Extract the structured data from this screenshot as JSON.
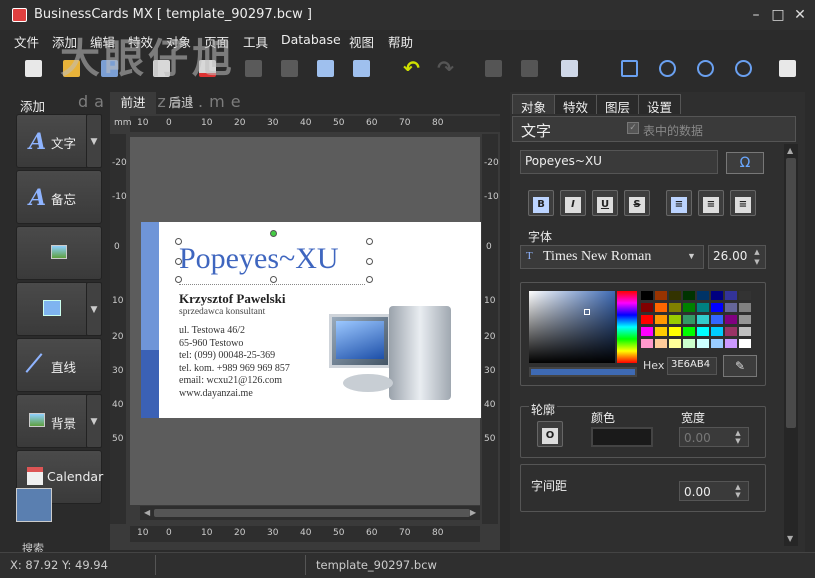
{
  "window": {
    "title": "BusinessCards MX [ template_90297.bcw ]",
    "minimize": "–",
    "maximize": "□",
    "close": "✕"
  },
  "menu": [
    "文件",
    "添加",
    "编辑",
    "特效",
    "对象",
    "页面",
    "工具",
    "Database",
    "视图",
    "帮助"
  ],
  "watermark": {
    "cn": "大眼仔旭",
    "en": "dayanzai.me"
  },
  "left_panel": {
    "tab": "添加",
    "tools": [
      {
        "label": "文字",
        "icon": "text-icon",
        "has_dropdown": true
      },
      {
        "label": "备忘",
        "icon": "memo-icon",
        "has_dropdown": false
      },
      {
        "label": "",
        "icon": "image-icon",
        "has_dropdown": false
      },
      {
        "label": "",
        "icon": "rectangle-icon",
        "has_dropdown": true
      },
      {
        "label": "直线",
        "icon": "line-icon",
        "has_dropdown": false
      },
      {
        "label": "背景",
        "icon": "background-icon",
        "has_dropdown": true
      },
      {
        "label": "Calendar",
        "icon": "calendar-icon",
        "has_dropdown": false
      }
    ],
    "search_label": "搜索"
  },
  "canvas": {
    "tabs": [
      "前进",
      "后退"
    ],
    "ruler_unit": "mm",
    "ruler_top": [
      "10",
      "0",
      "10",
      "20",
      "30",
      "40",
      "50",
      "60",
      "70",
      "80"
    ],
    "ruler_bottom": [
      "10",
      "0",
      "10",
      "20",
      "30",
      "40",
      "50",
      "60",
      "70",
      "80"
    ],
    "ruler_left": [
      "-20",
      "-10",
      "0",
      "10",
      "20",
      "30",
      "40",
      "50"
    ],
    "ruler_right": [
      "-20",
      "-10",
      "0",
      "10",
      "20",
      "30",
      "40",
      "50"
    ]
  },
  "card": {
    "name": "Popeyes~XU",
    "person": "Krzysztof Pawelski",
    "role": "sprzedawca konsultant",
    "lines": [
      "ul. Testowa 46/2",
      "65-960 Testowo",
      "tel: (099) 00048-25-369",
      "tel. kom. +989 969 969 857",
      "email: wcxu21@126.com",
      "www.dayanzai.me"
    ]
  },
  "right_panel": {
    "tabs": [
      "对象",
      "特效",
      "图层",
      "设置"
    ],
    "section_title": "文字",
    "table_data_label": "表中的数据",
    "text_value": "Popeyes~XU",
    "omega": "Ω",
    "format_buttons": [
      "B",
      "I",
      "U",
      "S"
    ],
    "font_label": "字体",
    "font_name": "Times New Roman",
    "font_size": "26.00",
    "hex_label": "Hex",
    "hex_value": "3E6AB4",
    "outline_label": "轮廓",
    "color_label": "颜色",
    "width_label": "宽度",
    "width_value": "0.00",
    "spacing_label": "字间距",
    "spacing_value": "0.00"
  },
  "status": {
    "coords": "X: 87.92 Y: 49.94",
    "file": "template_90297.bcw"
  },
  "colors": {
    "accent": "#3E6AB4",
    "swatches": [
      "#000000",
      "#993300",
      "#333300",
      "#003300",
      "#003366",
      "#000080",
      "#333399",
      "#333333",
      "#800000",
      "#ff6600",
      "#808000",
      "#008000",
      "#008080",
      "#0000ff",
      "#666699",
      "#808080",
      "#ff0000",
      "#ff9900",
      "#99cc00",
      "#339966",
      "#33cccc",
      "#3366ff",
      "#800080",
      "#969696",
      "#ff00ff",
      "#ffcc00",
      "#ffff00",
      "#00ff00",
      "#00ffff",
      "#00ccff",
      "#993366",
      "#c0c0c0",
      "#ff99cc",
      "#ffcc99",
      "#ffff99",
      "#ccffcc",
      "#ccffff",
      "#99ccff",
      "#cc99ff",
      "#ffffff"
    ]
  }
}
